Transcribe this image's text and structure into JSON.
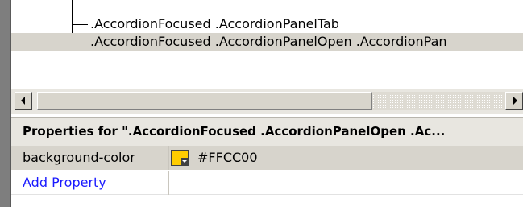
{
  "tree": {
    "rows": [
      {
        "label": ".AccordionFocused .AccordionPanelTab",
        "selected": false
      },
      {
        "label": ".AccordionFocused .AccordionPanelOpen .AccordionPan",
        "selected": true
      }
    ]
  },
  "scrollbar": {
    "left_icon": "arrow-left-icon",
    "right_icon": "arrow-right-icon"
  },
  "properties": {
    "header": "Properties for \".AccordionFocused .AccordionPanelOpen .Ac...",
    "rows": [
      {
        "name": "background-color",
        "value": "#FFCC00",
        "swatch_color": "#FFCC00"
      }
    ],
    "add_label": "Add Property"
  }
}
